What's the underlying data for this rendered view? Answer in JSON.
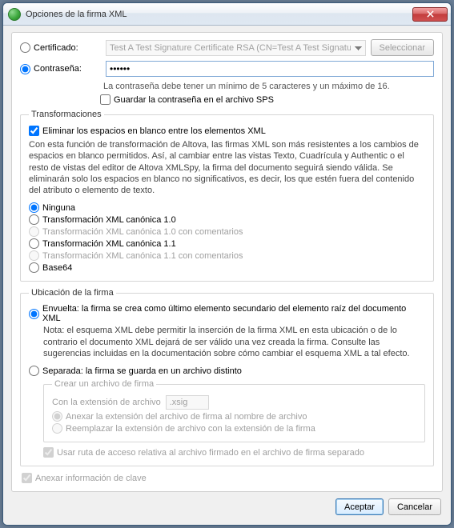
{
  "window": {
    "title": "Opciones de la firma XML"
  },
  "auth": {
    "cert_label": "Certificado:",
    "cert_value": "Test A Test Signature Certificate RSA (CN=Test A Test Signature Certifica",
    "select_btn": "Seleccionar",
    "pwd_label": "Contraseña:",
    "pwd_value": "••••••",
    "pwd_hint": "La contraseña debe tener un mínimo de 5 caracteres y un máximo de 16.",
    "save_pwd": "Guardar la contraseña en el archivo SPS"
  },
  "transform": {
    "legend": "Transformaciones",
    "strip_ws": "Eliminar los espacios en blanco entre los elementos XML",
    "desc": "Con esta función de transformación de Altova, las firmas XML son más resistentes a los cambios de espacios en blanco permitidos. Así, al cambiar entre las vistas Texto, Cuadrícula y Authentic o el resto de vistas del editor de Altova XMLSpy, la firma del documento seguirá siendo válida. Se eliminarán solo los espacios en blanco no significativos, es decir, los que estén fuera del contenido del atributo o elemento de texto.",
    "r_none": "Ninguna",
    "r_c10": "Transformación XML canónica 1.0",
    "r_c10c": "Transformación XML canónica 1.0 con comentarios",
    "r_c11": "Transformación XML canónica 1.1",
    "r_c11c": "Transformación XML canónica 1.1 con comentarios",
    "r_b64": "Base64"
  },
  "placement": {
    "legend": "Ubicación de la firma",
    "r_env": "Envuelta: la firma se crea como último elemento secundario del elemento raíz del documento XML",
    "env_note": "Nota: el esquema XML debe permitir la inserción de la firma XML en esta ubicación o de lo contrario el documento XML dejará de ser válido una vez creada la firma. Consulte las sugerencias incluidas en la documentación sobre cómo cambiar el esquema XML a tal efecto.",
    "r_sep": "Separada: la firma se guarda en un archivo distinto",
    "sigfile": {
      "legend": "Crear un archivo de firma",
      "ext_label": "Con la extensión de archivo",
      "ext_value": ".xsig",
      "r_append": "Anexar la extensión del archivo de firma al nombre de archivo",
      "r_replace": "Reemplazar la extensión de archivo con la extensión de la firma"
    },
    "rel_path": "Usar ruta de acceso relativa al archivo firmado en el archivo de firma separado"
  },
  "append_key": "Anexar información de clave",
  "buttons": {
    "ok": "Aceptar",
    "cancel": "Cancelar"
  }
}
